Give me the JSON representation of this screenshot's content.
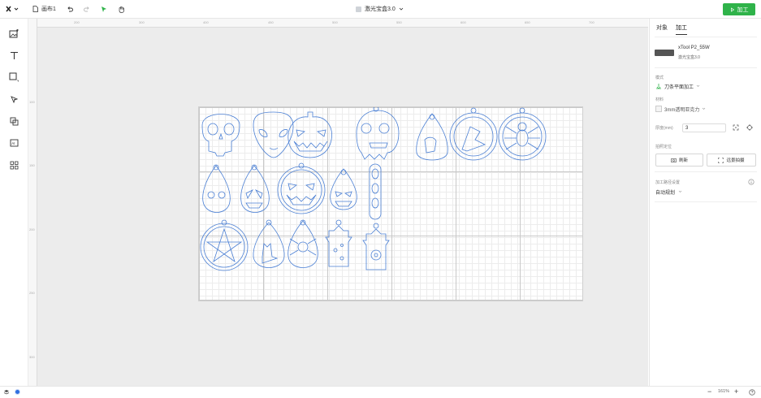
{
  "topbar": {
    "canvas_name": "画布1",
    "document_title": "激光宝盒3.0",
    "process_button": "加工"
  },
  "rulers": {
    "top": [
      "200",
      "300",
      "400",
      "450",
      "500",
      "550",
      "600",
      "650",
      "700"
    ],
    "left": [
      "100",
      "150",
      "200",
      "250",
      "300"
    ]
  },
  "left_tools": [
    "image-icon",
    "text-icon",
    "shape-icon",
    "pen-icon",
    "layers-icon",
    "ai-icon",
    "apps-icon"
  ],
  "panel": {
    "tabs": [
      "对象",
      "加工"
    ],
    "active_tab": "加工",
    "machine_name": "xTool P2_55W",
    "machine_sub": "激光宝盒3.0",
    "mode_label": "模式",
    "mode_value": "刀条平面加工",
    "material_label": "材料",
    "material_value": "3mm透明亚克力",
    "thickness_label": "厚度(mm)",
    "thickness_value": "3",
    "positioning_label": "拍照定位",
    "refresh_label": "刷新",
    "retake_label": "远景拍摄",
    "path_settings_label": "加工路径设置",
    "path_value": "自动规划"
  },
  "status": {
    "zoom": "161%"
  },
  "colors": {
    "accent": "#2fb34a",
    "design_stroke": "#4a7fd4"
  }
}
